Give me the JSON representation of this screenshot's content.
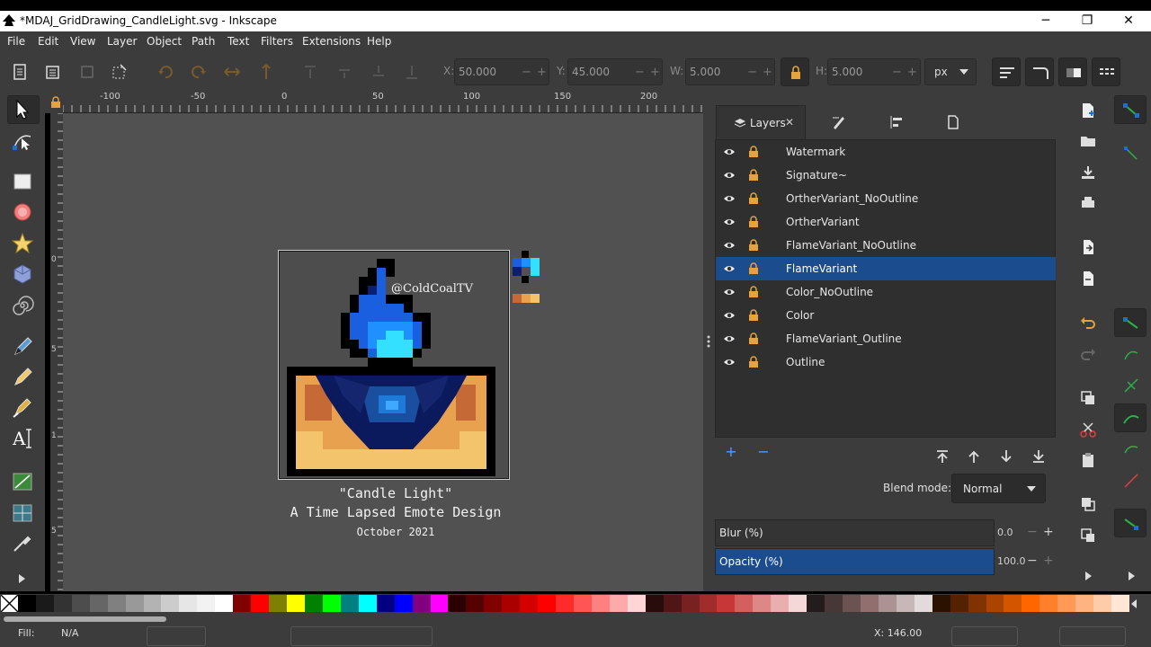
{
  "window": {
    "title": "*MDAJ_GridDrawing_CandleLight.svg - Inkscape",
    "minimize": "─",
    "maximize": "❐",
    "close": "✕"
  },
  "menu": [
    "File",
    "Edit",
    "View",
    "Layer",
    "Object",
    "Path",
    "Text",
    "Filters",
    "Extensions",
    "Help"
  ],
  "toolbar": {
    "x_label": "X:",
    "x_value": "50.000",
    "y_label": "Y:",
    "y_value": "45.000",
    "w_label": "W:",
    "w_value": "5.000",
    "h_label": "H:",
    "h_value": "5.000",
    "unit": "px",
    "minus": "−",
    "plus": "+"
  },
  "ruler": {
    "top_labels": [
      "-100",
      "-50",
      "0",
      "50",
      "100",
      "150",
      "200"
    ],
    "left_labels": [
      "0",
      "5",
      "1",
      "5"
    ]
  },
  "canvas": {
    "watermark": "@ColdCoalTV",
    "caption_title": "\"Candle Light\"",
    "caption_subtitle": "A Time Lapsed Emote Design",
    "caption_date": "October 2021"
  },
  "dock": {
    "active_tab": "Layers",
    "close_glyph": "✕",
    "layers": [
      {
        "name": "Watermark",
        "selected": false
      },
      {
        "name": "Signature~",
        "selected": false
      },
      {
        "name": "OrtherVariant_NoOutline",
        "selected": false
      },
      {
        "name": "OrtherVariant",
        "selected": false
      },
      {
        "name": "FlameVariant_NoOutline",
        "selected": false
      },
      {
        "name": "FlameVariant",
        "selected": true
      },
      {
        "name": "Color_NoOutline",
        "selected": false
      },
      {
        "name": "Color",
        "selected": false
      },
      {
        "name": "FlameVariant_Outline",
        "selected": false
      },
      {
        "name": "Outline",
        "selected": false
      }
    ],
    "add_glyph": "+",
    "remove_glyph": "−",
    "blend_label": "Blend mode:",
    "blend_value": "Normal",
    "blur_label": "Blur (%)",
    "blur_value": "0.0",
    "opacity_label": "Opacity (%)",
    "opacity_value": "100.0",
    "minus": "−",
    "plus": "+"
  },
  "status": {
    "fill_label": "Fill:",
    "fill_value": "N/A",
    "x_readout": "X: 146.00"
  },
  "palette": [
    "#000000",
    "#1a1a1a",
    "#333333",
    "#4d4d4d",
    "#666666",
    "#808080",
    "#999999",
    "#b3b3b3",
    "#cccccc",
    "#e6e6e6",
    "#f2f2f2",
    "#ffffff",
    "#800000",
    "#ff0000",
    "#808000",
    "#ffff00",
    "#008000",
    "#00ff00",
    "#008080",
    "#00ffff",
    "#000080",
    "#0000ff",
    "#800080",
    "#ff00ff",
    "#2b0000",
    "#550000",
    "#800000",
    "#aa0000",
    "#d40000",
    "#ff0000",
    "#ff2a2a",
    "#ff5555",
    "#ff8080",
    "#ffaaaa",
    "#ffd5d5",
    "#280b0b",
    "#501616",
    "#782121",
    "#a02c2c",
    "#c83737",
    "#d35f5f",
    "#de8787",
    "#e9afaf",
    "#f4d7d7",
    "#241c1c",
    "#483737",
    "#6c5353",
    "#916f6f",
    "#ac9393",
    "#c8b7b7",
    "#e3dbdb",
    "#2b1100",
    "#552200",
    "#803300",
    "#aa4400",
    "#d45500",
    "#ff6600",
    "#ff7f2a",
    "#ff9955",
    "#ffb380",
    "#ffccaa",
    "#ffe6d5"
  ]
}
